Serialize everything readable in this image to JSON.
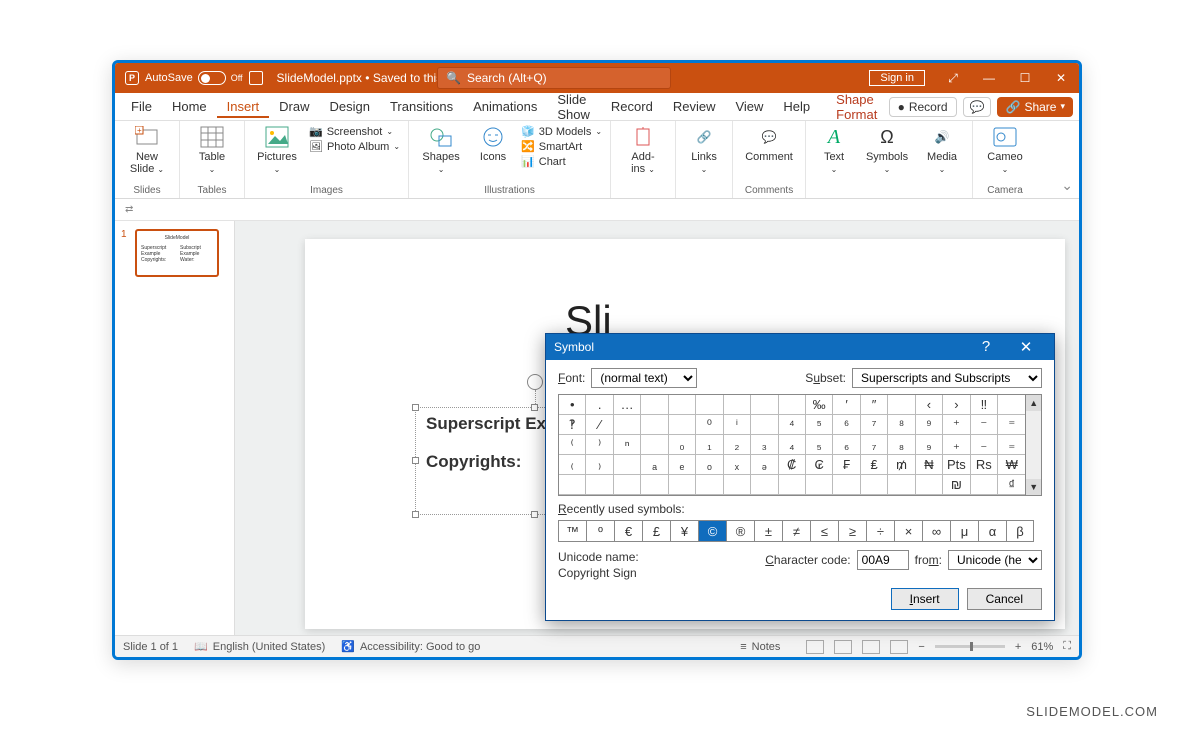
{
  "titlebar": {
    "autosave_label": "AutoSave",
    "autosave_value": "Off",
    "filename": "SlideModel.pptx",
    "saved_state": "Saved to this PC",
    "search_placeholder": "Search (Alt+Q)",
    "sign_in": "Sign in"
  },
  "menu": {
    "items": [
      "File",
      "Home",
      "Insert",
      "Draw",
      "Design",
      "Transitions",
      "Animations",
      "Slide Show",
      "Record",
      "Review",
      "View",
      "Help",
      "Shape Format"
    ],
    "record_btn": "Record",
    "share_btn": "Share"
  },
  "ribbon": {
    "slides": {
      "new_slide": "New\nSlide",
      "group": "Slides"
    },
    "tables": {
      "table": "Table",
      "group": "Tables"
    },
    "images": {
      "pictures": "Pictures",
      "screenshot": "Screenshot",
      "photo_album": "Photo Album",
      "group": "Images"
    },
    "illustrations": {
      "shapes": "Shapes",
      "icons": "Icons",
      "models": "3D Models",
      "smartart": "SmartArt",
      "chart": "Chart",
      "group": "Illustrations"
    },
    "addins": {
      "btn": "Add-\nins",
      "group": ""
    },
    "links": {
      "btn": "Links",
      "group": ""
    },
    "comments": {
      "btn": "Comment",
      "group": "Comments"
    },
    "text": {
      "btn": "Text",
      "group": ""
    },
    "symbols": {
      "btn": "Symbols",
      "group": ""
    },
    "media": {
      "btn": "Media",
      "group": ""
    },
    "cameo": {
      "btn": "Cameo",
      "group": "Camera"
    }
  },
  "thumb": {
    "index": "1",
    "title": "SlideModel",
    "l1": "Superscript Example",
    "l2": "Copyrights:",
    "r1": "Subscript Example",
    "r2": "Water:"
  },
  "slide": {
    "title_visible": "Sli",
    "textbox_line1": "Superscript Example",
    "textbox_line2": "Copyrights:"
  },
  "dialog": {
    "title": "Symbol",
    "font_label": "Font:",
    "font_value": "(normal text)",
    "subset_label": "Subset:",
    "subset_value": "Superscripts and Subscripts",
    "grid": [
      [
        "•",
        ".",
        "…",
        "",
        "",
        "",
        "",
        "",
        "",
        "‰",
        "′",
        "″",
        "",
        "‹",
        "›",
        "‼"
      ],
      [
        "‽",
        "⁄",
        "",
        "",
        "",
        "⁰",
        "ⁱ",
        "",
        "⁴",
        "⁵",
        "⁶",
        "⁷",
        "⁸",
        "⁹",
        "⁺",
        "⁻",
        "⁼"
      ],
      [
        "⁽",
        "⁾",
        "ⁿ",
        "",
        "₀",
        "₁",
        "₂",
        "₃",
        "₄",
        "₅",
        "₆",
        "₇",
        "₈",
        "₉",
        "₊",
        "₋",
        "₌"
      ],
      [
        "₍",
        "₎",
        "",
        "ₐ",
        "ₑ",
        "ₒ",
        "ₓ",
        "ₔ",
        "₡",
        "₢",
        "₣",
        "₤",
        "₥",
        "₦",
        "Pts",
        "Rs",
        "₩"
      ],
      [
        "",
        "",
        "",
        "",
        "",
        "",
        "",
        "",
        "",
        "",
        "",
        "",
        "",
        "",
        "₪",
        "",
        "₫"
      ]
    ],
    "grid_rows_shown": 4,
    "last_row_extra": [
      "₪",
      "",
      "₫"
    ],
    "recent_label": "Recently used symbols:",
    "recent": [
      "™",
      "º",
      "€",
      "£",
      "¥",
      "©",
      "®",
      "±",
      "≠",
      "≤",
      "≥",
      "÷",
      "×",
      "∞",
      "μ",
      "α",
      "β"
    ],
    "recent_selected_index": 5,
    "unicode_name_label": "Unicode name:",
    "unicode_name": "Copyright Sign",
    "charcode_label": "Character code:",
    "charcode_value": "00A9",
    "from_label": "from:",
    "from_value": "Unicode (hex)",
    "insert_btn": "Insert",
    "cancel_btn": "Cancel"
  },
  "statusbar": {
    "slide": "Slide 1 of 1",
    "lang": "English (United States)",
    "access": "Accessibility: Good to go",
    "notes": "Notes",
    "zoom": "61%"
  },
  "attribution": "SLIDEMODEL.COM"
}
